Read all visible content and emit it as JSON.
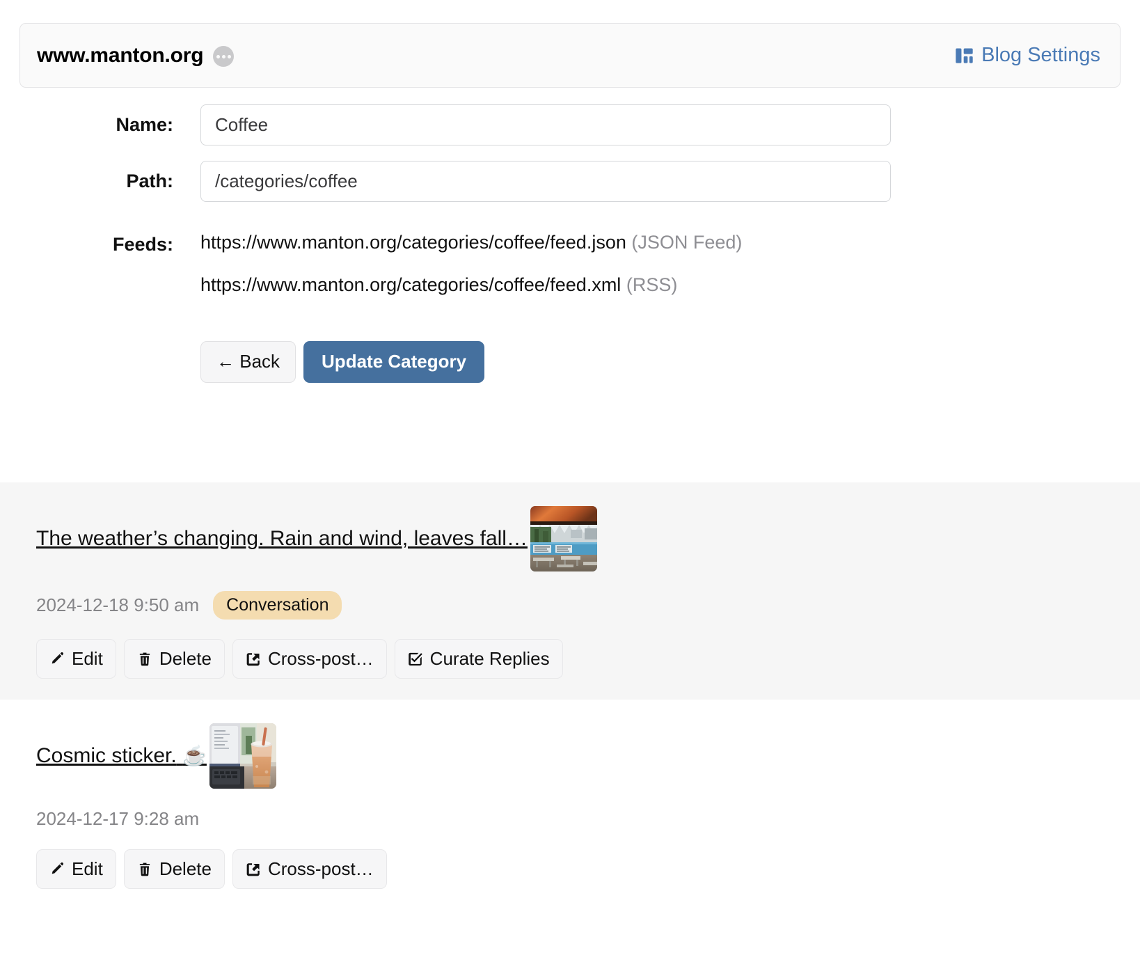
{
  "header": {
    "site_title": "www.manton.org",
    "menu_icon": "ellipsis-icon",
    "blog_settings_label": "Blog Settings",
    "blog_settings_icon": "dashboard-layout-icon",
    "accent_color": "#4a7ab5"
  },
  "form": {
    "name": {
      "label": "Name:",
      "value": "Coffee",
      "placeholder": "Name"
    },
    "path": {
      "label": "Path:",
      "value": "/categories/coffee",
      "placeholder": "Path"
    },
    "feeds": {
      "label": "Feeds:",
      "items": [
        {
          "url": "https://www.manton.org/categories/coffee/feed.json",
          "kind": "(JSON Feed)"
        },
        {
          "url": "https://www.manton.org/categories/coffee/feed.xml",
          "kind": "(RSS)"
        }
      ]
    },
    "back_label": "← Back",
    "update_label": "Update Category",
    "primary_color": "#45709e"
  },
  "posts": [
    {
      "title": "The weather’s changing. Rain and wind, leaves fall…",
      "emoji": "",
      "thumbnail": "outdoor-patio-picnic-tables-photo",
      "date": "2024-12-18 9:50 am",
      "badge": "Conversation",
      "badge_color": "#f4dcb0",
      "highlighted": true,
      "actions": [
        {
          "label": "Edit",
          "icon": "pencil-icon"
        },
        {
          "label": "Delete",
          "icon": "trash-icon"
        },
        {
          "label": "Cross-post…",
          "icon": "share-box-arrow-icon"
        },
        {
          "label": "Curate Replies",
          "icon": "check-square-icon"
        }
      ]
    },
    {
      "title": "Cosmic sticker.",
      "emoji": "☕",
      "thumbnail": "laptop-with-iced-coffee-photo",
      "date": "2024-12-17 9:28 am",
      "badge": "",
      "badge_color": "",
      "highlighted": false,
      "actions": [
        {
          "label": "Edit",
          "icon": "pencil-icon"
        },
        {
          "label": "Delete",
          "icon": "trash-icon"
        },
        {
          "label": "Cross-post…",
          "icon": "share-box-arrow-icon"
        }
      ]
    }
  ]
}
